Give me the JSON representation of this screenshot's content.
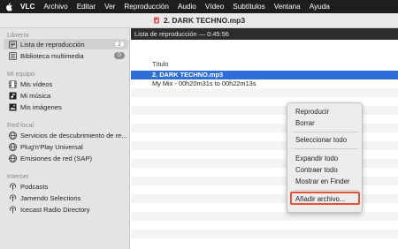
{
  "menubar": {
    "app": "VLC",
    "items": [
      "Archivo",
      "Editar",
      "Ver",
      "Reproducción",
      "Audio",
      "Vídeo",
      "Subtítulos",
      "Ventana",
      "Ayuda"
    ]
  },
  "window": {
    "title": "2. DARK TECHNO.mp3"
  },
  "sidebar": {
    "sections": [
      {
        "header": "Librería"
      },
      {
        "header": "Mi equipo"
      },
      {
        "header": "Red local"
      },
      {
        "header": "Internet"
      }
    ],
    "library": [
      {
        "label": "Lista de reproducción",
        "count": "2",
        "icon": "playlist-icon"
      },
      {
        "label": "Biblioteca multimedia",
        "count": "0",
        "icon": "media-library-icon"
      }
    ],
    "computer": [
      {
        "label": "Mis vídeos",
        "icon": "film-icon"
      },
      {
        "label": "Mi música",
        "icon": "music-icon"
      },
      {
        "label": "Mis imágenes",
        "icon": "image-icon"
      }
    ],
    "network": [
      {
        "label": "Servicios de descubrimiento de re...",
        "icon": "network-icon"
      },
      {
        "label": "Plug'n'Play Universal",
        "icon": "upnp-icon"
      },
      {
        "label": "Emisiones de red (SAP)",
        "icon": "sap-icon"
      }
    ],
    "internet": [
      {
        "label": "Podcasts",
        "icon": "podcast-icon"
      },
      {
        "label": "Jamendo Selections",
        "icon": "jamendo-icon"
      },
      {
        "label": "Icecast Radio Directory",
        "icon": "radio-icon"
      }
    ]
  },
  "playlist": {
    "header": "Lista de reproducción — 0:45:56",
    "column_title": "Título",
    "rows": [
      {
        "text": "2. DARK TECHNO.mp3",
        "selected": true
      },
      {
        "text": "My Mix - 00h20m31s to 00h22m13s",
        "selected": false
      }
    ]
  },
  "context_menu": {
    "items": [
      "Reproducir",
      "Borrar",
      "Seleccionar todo",
      "Expandir todo",
      "Contraer todo",
      "Mostrar en Finder",
      "Añadir archivo..."
    ],
    "highlight_color": "#e8522f"
  },
  "colors": {
    "selection": "#2f6ed9",
    "menubar": "#1e1e1e"
  }
}
